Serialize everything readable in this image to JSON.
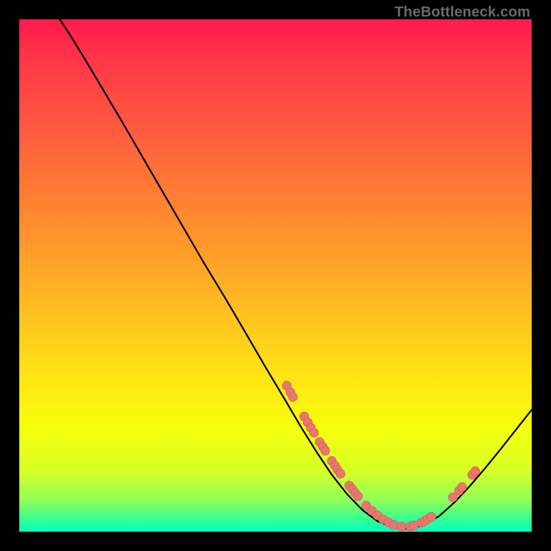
{
  "watermark": "TheBottleneck.com",
  "chart_data": {
    "type": "line",
    "title": "",
    "xlabel": "",
    "ylabel": "",
    "xlim": [
      0,
      100
    ],
    "ylim": [
      0,
      100
    ],
    "grid": false,
    "legend": false,
    "curve": [
      {
        "x": 7.9,
        "y": 100.0
      },
      {
        "x": 10.0,
        "y": 96.8
      },
      {
        "x": 13.0,
        "y": 91.9
      },
      {
        "x": 16.5,
        "y": 86.0
      },
      {
        "x": 20.0,
        "y": 80.1
      },
      {
        "x": 24.0,
        "y": 73.2
      },
      {
        "x": 28.0,
        "y": 66.3
      },
      {
        "x": 32.0,
        "y": 59.4
      },
      {
        "x": 36.0,
        "y": 52.5
      },
      {
        "x": 40.0,
        "y": 45.9
      },
      {
        "x": 44.0,
        "y": 39.1
      },
      {
        "x": 48.0,
        "y": 32.2
      },
      {
        "x": 52.0,
        "y": 25.5
      },
      {
        "x": 55.0,
        "y": 20.4
      },
      {
        "x": 58.0,
        "y": 15.6
      },
      {
        "x": 61.0,
        "y": 11.1
      },
      {
        "x": 64.0,
        "y": 7.3
      },
      {
        "x": 67.0,
        "y": 4.2
      },
      {
        "x": 70.0,
        "y": 2.0
      },
      {
        "x": 73.0,
        "y": 0.8
      },
      {
        "x": 76.0,
        "y": 0.5
      },
      {
        "x": 79.0,
        "y": 1.3
      },
      {
        "x": 82.0,
        "y": 3.1
      },
      {
        "x": 85.0,
        "y": 5.8
      },
      {
        "x": 88.0,
        "y": 9.0
      },
      {
        "x": 91.0,
        "y": 12.5
      },
      {
        "x": 94.0,
        "y": 16.2
      },
      {
        "x": 97.0,
        "y": 20.0
      },
      {
        "x": 100.0,
        "y": 23.8
      }
    ],
    "points": [
      {
        "x": 52.2,
        "y": 28.5
      },
      {
        "x": 52.9,
        "y": 27.2
      },
      {
        "x": 53.4,
        "y": 26.3
      },
      {
        "x": 55.6,
        "y": 22.5
      },
      {
        "x": 56.3,
        "y": 21.3
      },
      {
        "x": 56.9,
        "y": 20.3
      },
      {
        "x": 57.5,
        "y": 19.3
      },
      {
        "x": 58.6,
        "y": 17.5
      },
      {
        "x": 59.2,
        "y": 16.6
      },
      {
        "x": 59.7,
        "y": 15.8
      },
      {
        "x": 61.0,
        "y": 13.8
      },
      {
        "x": 61.6,
        "y": 12.9
      },
      {
        "x": 62.1,
        "y": 12.1
      },
      {
        "x": 62.7,
        "y": 11.3
      },
      {
        "x": 64.4,
        "y": 9.0
      },
      {
        "x": 65.0,
        "y": 8.3
      },
      {
        "x": 65.5,
        "y": 7.6
      },
      {
        "x": 66.1,
        "y": 6.9
      },
      {
        "x": 67.7,
        "y": 5.1
      },
      {
        "x": 68.8,
        "y": 4.1
      },
      {
        "x": 69.9,
        "y": 3.2
      },
      {
        "x": 71.0,
        "y": 2.4
      },
      {
        "x": 72.1,
        "y": 1.8
      },
      {
        "x": 73.1,
        "y": 1.3
      },
      {
        "x": 74.6,
        "y": 1.0
      },
      {
        "x": 76.3,
        "y": 1.0
      },
      {
        "x": 77.0,
        "y": 1.2
      },
      {
        "x": 78.5,
        "y": 1.8
      },
      {
        "x": 79.1,
        "y": 2.1
      },
      {
        "x": 79.7,
        "y": 2.5
      },
      {
        "x": 80.4,
        "y": 2.9
      },
      {
        "x": 84.6,
        "y": 6.7
      },
      {
        "x": 85.8,
        "y": 8.0
      },
      {
        "x": 86.4,
        "y": 8.7
      },
      {
        "x": 88.4,
        "y": 11.1
      },
      {
        "x": 89.0,
        "y": 11.8
      }
    ],
    "annotations": []
  },
  "colors": {
    "curve_stroke": "#000000",
    "point_fill": "#e9766f",
    "point_stroke": "#d85f58"
  }
}
